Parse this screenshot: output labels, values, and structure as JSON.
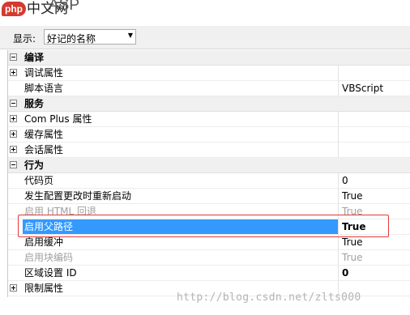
{
  "header": {
    "logo_badge": "php",
    "logo_text": "中文网",
    "faded_title": "ASP"
  },
  "toolbar": {
    "display_label": "显示:",
    "sort_value": "好记的名称"
  },
  "grid": {
    "rows": [
      {
        "type": "category",
        "expander": "minus",
        "name": "编译",
        "value": ""
      },
      {
        "type": "item",
        "expander": "plus",
        "name": "调试属性",
        "value": ""
      },
      {
        "type": "item",
        "expander": "",
        "name": "脚本语言",
        "value": "VBScript"
      },
      {
        "type": "category",
        "expander": "minus",
        "name": "服务",
        "value": ""
      },
      {
        "type": "item",
        "expander": "plus",
        "name": "Com Plus 属性",
        "value": ""
      },
      {
        "type": "item",
        "expander": "plus",
        "name": "缓存属性",
        "value": ""
      },
      {
        "type": "item",
        "expander": "plus",
        "name": "会话属性",
        "value": ""
      },
      {
        "type": "category",
        "expander": "minus",
        "name": "行为",
        "value": ""
      },
      {
        "type": "item",
        "expander": "",
        "name": "代码页",
        "value": "0"
      },
      {
        "type": "item",
        "expander": "",
        "name": "发生配置更改时重新启动",
        "value": "True"
      },
      {
        "type": "disabled",
        "expander": "",
        "name": "启用 HTML 回退",
        "value": "True"
      },
      {
        "type": "selected",
        "expander": "",
        "name": "启用父路径",
        "value": "True"
      },
      {
        "type": "item",
        "expander": "",
        "name": "启用缓冲",
        "value": "True"
      },
      {
        "type": "disabled",
        "expander": "",
        "name": "启用块编码",
        "value": "True"
      },
      {
        "type": "boldval",
        "expander": "",
        "name": "区域设置 ID",
        "value": "0"
      },
      {
        "type": "item",
        "expander": "plus",
        "name": "限制属性",
        "value": ""
      }
    ]
  },
  "watermark": "http://blog.csdn.net/zlts000",
  "colors": {
    "selection": "#3399ff",
    "highlight_box": "#e23a3a",
    "category_bg": "#f0f0f0"
  }
}
